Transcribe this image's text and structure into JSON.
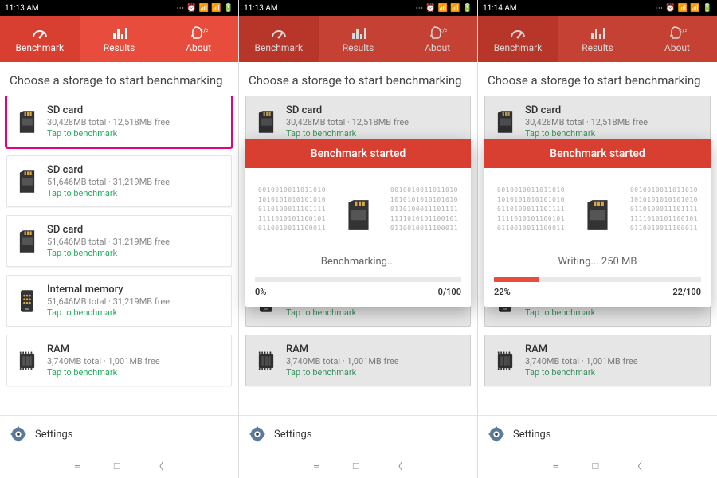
{
  "screens": [
    {
      "time": "11:13 AM",
      "highlight": true,
      "dimTabs": false
    },
    {
      "time": "11:13 AM",
      "highlight": false,
      "dimTabs": true,
      "overlay": {
        "title": "Benchmark started",
        "status": "Benchmarking...",
        "percent": 0,
        "percentLabel": "0%",
        "countLabel": "0/100"
      }
    },
    {
      "time": "11:14 AM",
      "highlight": false,
      "dimTabs": true,
      "overlay": {
        "title": "Benchmark started",
        "status": "Writing... 250 MB",
        "percent": 22,
        "percentLabel": "22%",
        "countLabel": "22/100"
      }
    }
  ],
  "tabs": {
    "benchmark": "Benchmark",
    "results": "Results",
    "about": "About"
  },
  "heading": "Choose a storage to start benchmarking",
  "tap": "Tap to benchmark",
  "storage": [
    {
      "title": "SD card",
      "sub": "30,428MB total · 12,518MB free",
      "icon": "sd"
    },
    {
      "title": "SD card",
      "sub": "51,646MB total · 31,219MB free",
      "icon": "sd"
    },
    {
      "title": "SD card",
      "sub": "51,646MB total · 31,219MB free",
      "icon": "sd"
    },
    {
      "title": "Internal memory",
      "sub": "51,646MB total · 31,219MB free",
      "icon": "phone"
    },
    {
      "title": "RAM",
      "sub": "3,740MB total · 1,001MB free",
      "icon": "ram"
    }
  ],
  "settings": "Settings",
  "binary": "0010010011011010\n1010101010101010\n0110100011101111\n1111010101100101\n0110010011100011"
}
